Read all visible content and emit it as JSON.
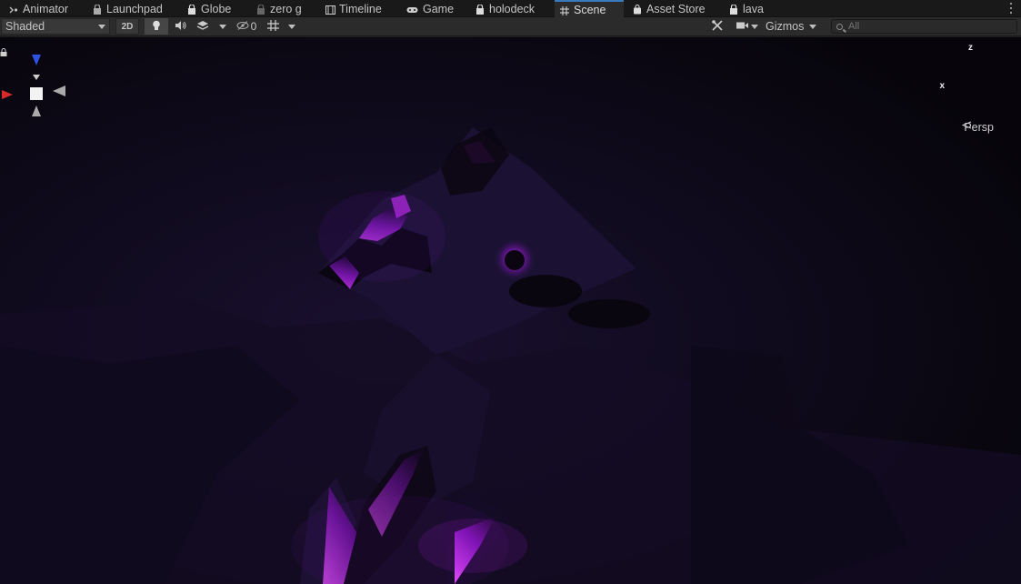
{
  "tabs": [
    {
      "label": "Animator",
      "icon": "animator-icon"
    },
    {
      "label": "Launchpad",
      "icon": "prefab-lock-icon"
    },
    {
      "label": "Globe",
      "icon": "prefab-lock-icon"
    },
    {
      "label": "zero g",
      "icon": "prefab-lock-icon"
    },
    {
      "label": "Timeline",
      "icon": "timeline-icon"
    },
    {
      "label": "Game",
      "icon": "gamepad-icon"
    },
    {
      "label": "holodeck",
      "icon": "prefab-lock-icon"
    },
    {
      "label": "Scene",
      "icon": "scene-grid-icon",
      "active": true
    },
    {
      "label": "Asset Store",
      "icon": "shopping-bag-icon"
    },
    {
      "label": "lava",
      "icon": "prefab-lock-icon"
    }
  ],
  "toolbar": {
    "draw_mode": "Shaded",
    "toggle_2d": "2D",
    "hidden_count": "0",
    "gizmos_label": "Gizmos",
    "search_placeholder": "All"
  },
  "orientation_gizmo": {
    "z_label": "z",
    "x_label": "x",
    "projection_label": "Persp"
  },
  "colors": {
    "accent_tab": "#3a79bb",
    "glow_magenta": "#c21cff",
    "axis_x": "#d42a2a",
    "axis_z": "#2f53e0"
  }
}
